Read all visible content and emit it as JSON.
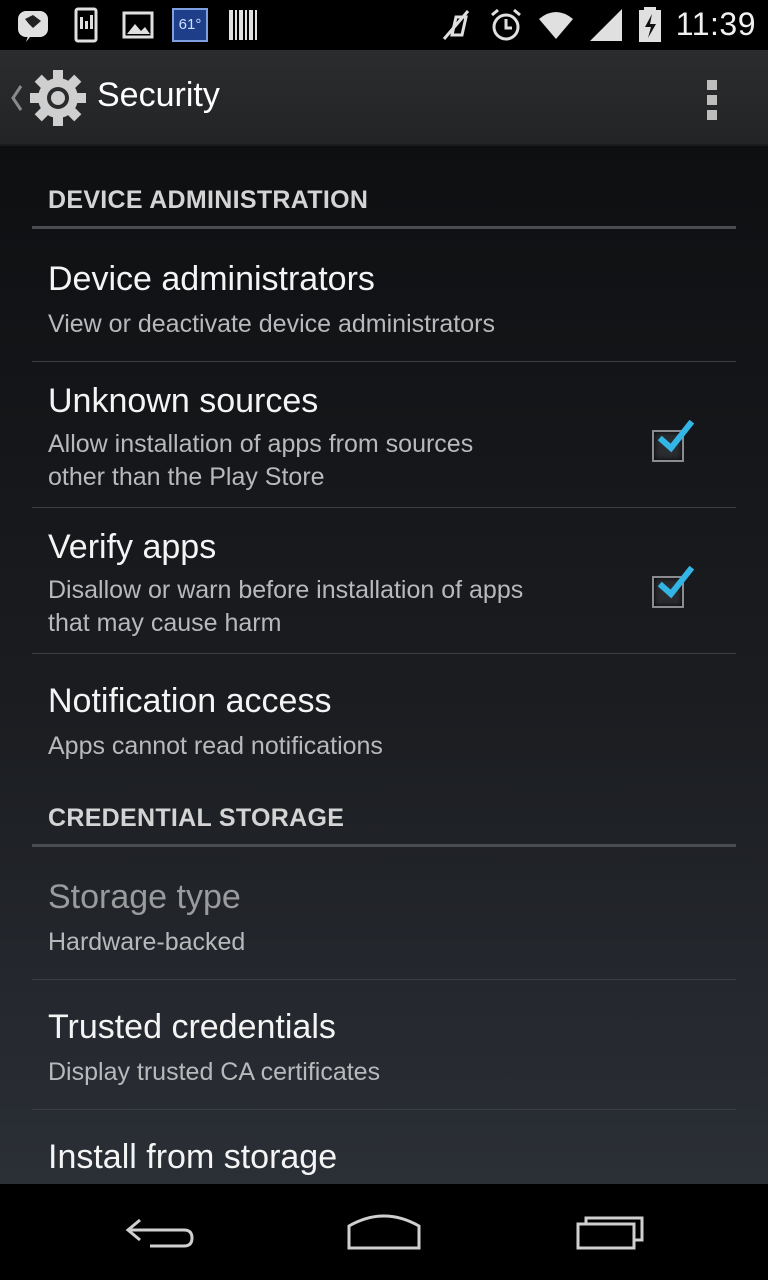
{
  "status_bar": {
    "time": "11:39",
    "weather_temp": "61°",
    "left_icons": [
      "speech-bubble-icon",
      "phone-status-icon",
      "image-icon",
      "weather-icon",
      "barcode-icon"
    ],
    "right_icons": [
      "muted-icon",
      "alarm-icon",
      "wifi-icon",
      "signal-icon",
      "battery-charging-icon"
    ]
  },
  "action_bar": {
    "title": "Security",
    "icon": "gear-icon",
    "overflow_icon": "overflow-menu-icon"
  },
  "sections": [
    {
      "header": "DEVICE ADMINISTRATION",
      "items": [
        {
          "title": "Device administrators",
          "summary": "View or deactivate device administrators",
          "checkbox": null
        },
        {
          "title": "Unknown sources",
          "summary_lines": [
            "Allow installation of apps from sources",
            "other than the Play Store"
          ],
          "checkbox": true
        },
        {
          "title": "Verify apps",
          "summary_lines": [
            "Disallow or warn before installation of apps",
            "that may cause harm"
          ],
          "checkbox": true
        },
        {
          "title": "Notification access",
          "summary": "Apps cannot read notifications",
          "checkbox": null
        }
      ]
    },
    {
      "header": "CREDENTIAL STORAGE",
      "items": [
        {
          "title": "Storage type",
          "summary": "Hardware-backed",
          "disabled": true
        },
        {
          "title": "Trusted credentials",
          "summary": "Display trusted CA certificates"
        },
        {
          "title": "Install from storage"
        }
      ]
    }
  ],
  "nav_bar": {
    "buttons": [
      "back-icon",
      "home-icon",
      "recent-apps-icon"
    ]
  },
  "colors": {
    "accent": "#33b5e5",
    "background": "#1b1d21"
  }
}
